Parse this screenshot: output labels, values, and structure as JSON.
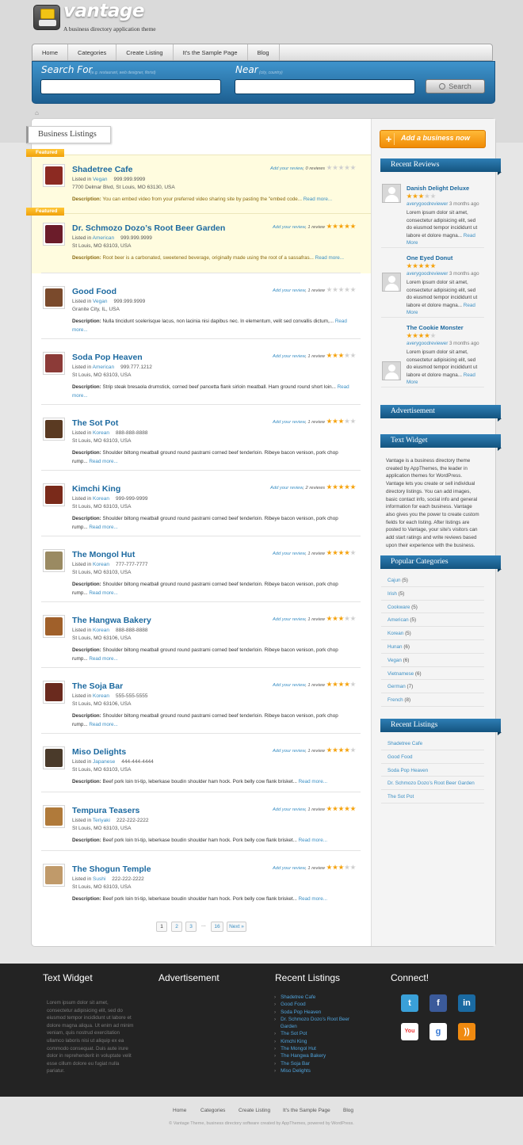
{
  "site": {
    "name": "vantage",
    "tagline": "A business directory application theme"
  },
  "nav": [
    "Home",
    "Categories",
    "Create Listing",
    "It's the Sample Page",
    "Blog"
  ],
  "search": {
    "for_label": "Search For",
    "for_hint": "(e.g. restaurant, web designer, florist)",
    "near_label": "Near",
    "near_hint": "(city, country)",
    "button": "Search"
  },
  "main": {
    "tab_title": "Business Listings",
    "featured_label": "Featured",
    "listed_in": "Listed in",
    "description_label": "Description:",
    "read_more": "Read more...",
    "add_review": "Add your review",
    "listings": [
      {
        "name": "Shadetree Cafe",
        "category": "Vegan",
        "phone": "999.999.9999",
        "address": "7700 Delmar Blvd, St Louis, MO 63130, USA",
        "reviews": ", 0 reviews",
        "rating": 0,
        "featured": true,
        "desc_a": "You can embed video from your preferred video sharing site by pasting the \"embed code...",
        "desc_b": "",
        "thumb": "#8c2a22"
      },
      {
        "name": "Dr. Schmozo Dozo’s Root Beer Garden",
        "category": "American",
        "phone": "999.999.9999",
        "address": "St Louis, MO 63103, USA",
        "reviews": ", 1 review",
        "rating": 5,
        "featured": true,
        "desc_a": "Root beer is a carbonated, sweetened beverage, originally made using the root of a sassafras...",
        "desc_b": "",
        "thumb": "#6b1c2a"
      },
      {
        "name": "Good Food",
        "category": "Vegan",
        "phone": "999.999.9999",
        "address": "Granite City, IL, USA",
        "reviews": ", 1 review",
        "rating": 0,
        "featured": false,
        "desc_a": "Nulla tincidunt scelerisque lacus, non lacinia nisi dapibus nec. In elementum, velit sed convallis dictum,...",
        "desc_b": "more...",
        "thumb": "#7a4a2c"
      },
      {
        "name": "Soda Pop Heaven",
        "category": "American",
        "phone": "999.777.1212",
        "address": "St Louis, MO 63103, USA",
        "reviews": ", 1 review",
        "rating": 3,
        "featured": false,
        "desc_a": "Strip steak bresaola drumstick, corned beef pancetta flank sirloin meatball. Ham ground round short loin...",
        "desc_b": "more...",
        "thumb": "#8c3b38"
      },
      {
        "name": "The Sot Pot",
        "category": "Korean",
        "phone": "888-888-8888",
        "address": "St Louis, MO 63103, USA",
        "reviews": ", 1 review",
        "rating": 3,
        "featured": false,
        "desc_a": "Shoulder biltong meatball ground round pastrami corned beef tenderloin. Ribeye bacon venison, pork chop",
        "desc_b": "rump...",
        "thumb": "#5a3a22"
      },
      {
        "name": "Kimchi King",
        "category": "Korean",
        "phone": "999-999-9999",
        "address": "St Louis, MO 63103, USA",
        "reviews": ", 2 reviews",
        "rating": 5,
        "featured": false,
        "desc_a": "Shoulder biltong meatball ground round pastrami corned beef tenderloin. Ribeye bacon venison, pork chop",
        "desc_b": "rump...",
        "thumb": "#7a2a1a"
      },
      {
        "name": "The Mongol Hut",
        "category": "Korean",
        "phone": "777-777-7777",
        "address": "St Louis, MO 63103, USA",
        "reviews": ", 1 review",
        "rating": 4,
        "featured": false,
        "desc_a": "Shoulder biltong meatball ground round pastrami corned beef tenderloin. Ribeye bacon venison, pork chop",
        "desc_b": "rump...",
        "thumb": "#9a8a62"
      },
      {
        "name": "The Hangwa Bakery",
        "category": "Korean",
        "phone": "888-888-8888",
        "address": "St Louis, MO 63106, USA",
        "reviews": ", 1 review",
        "rating": 3,
        "featured": false,
        "desc_a": "Shoulder biltong meatball ground round pastrami corned beef tenderloin. Ribeye bacon venison, pork chop",
        "desc_b": "rump...",
        "thumb": "#a0602a"
      },
      {
        "name": "The Soja Bar",
        "category": "Korean",
        "phone": "555-555-5555",
        "address": "St Louis, MO 63106, USA",
        "reviews": ", 1 review",
        "rating": 4,
        "featured": false,
        "desc_a": "Shoulder biltong meatball ground round pastrami corned beef tenderloin. Ribeye bacon venison, pork chop",
        "desc_b": "rump...",
        "thumb": "#6a2a1e"
      },
      {
        "name": "Miso Delights",
        "category": "Japanese",
        "phone": "444-444-4444",
        "address": "St Louis, MO 63103, USA",
        "reviews": ", 1 review",
        "rating": 4,
        "featured": false,
        "desc_a": "Beef pork loin tri-tip, leberkase boudin shoulder ham hock. Pork belly cow flank brisket...",
        "desc_b": "",
        "thumb": "#4a3a2a"
      },
      {
        "name": "Tempura Teasers",
        "category": "Teriyaki",
        "phone": "222-222-2222",
        "address": "St Louis, MO 63103, USA",
        "reviews": ", 1 review",
        "rating": 5,
        "featured": false,
        "desc_a": "Beef pork loin tri-tip, leberkase boudin shoulder ham hock. Pork belly cow flank brisket...",
        "desc_b": "",
        "thumb": "#b07a3a"
      },
      {
        "name": "The Shogun Temple",
        "category": "Sushi",
        "phone": "222-222-2222",
        "address": "St Louis, MO 63103, USA",
        "reviews": ", 1 review",
        "rating": 3,
        "featured": false,
        "desc_a": "Beef pork loin tri-tip, leberkase boudin shoulder ham hock. Pork belly cow flank brisket...",
        "desc_b": "",
        "thumb": "#c09a6a"
      }
    ],
    "pagination": [
      "1",
      "2",
      "3",
      "...",
      "16",
      "Next »"
    ]
  },
  "sidebar": {
    "add_button": "Add a business now",
    "recent_reviews_title": "Recent Reviews",
    "reviews": [
      {
        "title": "Danish Delight Deluxe",
        "rating": 3,
        "by": "averygoodreviewer",
        "when": "3 months ago",
        "text": "Lorem ipsum dolor sit amet, consectetur adipisicing elit, sed do eiusmod tempor incididunt ut labore et dolore magna...",
        "more": "Read More"
      },
      {
        "title": "One Eyed Donut",
        "rating": 5,
        "by": "averygoodreviewer",
        "when": "3 months ago",
        "text": "Lorem ipsum dolor sit amet, consectetur adipisicing elit, sed do eiusmod tempor incididunt ut labore et dolore magna...",
        "more": "Read More"
      },
      {
        "title": "The Cookie Monster",
        "rating": 4,
        "by": "averygoodreviewer",
        "when": "3 months ago",
        "text": "Lorem ipsum dolor sit amet, consectetur adipisicing elit, sed do eiusmod tempor incididunt ut labore et dolore magna...",
        "more": "Read More"
      }
    ],
    "advertisement_title": "Advertisement",
    "text_widget_title": "Text Widget",
    "text_widget_body": "Vantage is a business directory theme created by AppThemes, the leader in application themes for WordPress. Vantage lets you create or sell individual directory listings. You can add images, basic contact info, social info and general information for each business. Vantage also gives you the power to create custom fields for each listing. After listings are posted to Vantage, your site's visitors can add start ratings and write reviews based upon their experience with the business.",
    "popular_categories_title": "Popular Categories",
    "categories": [
      {
        "name": "Cajun",
        "count": "(5)"
      },
      {
        "name": "Irish",
        "count": "(5)"
      },
      {
        "name": "Cookware",
        "count": "(5)"
      },
      {
        "name": "American",
        "count": "(5)"
      },
      {
        "name": "Korean",
        "count": "(5)"
      },
      {
        "name": "Hunan",
        "count": "(6)"
      },
      {
        "name": "Vegan",
        "count": "(6)"
      },
      {
        "name": "Vietnamese",
        "count": "(6)"
      },
      {
        "name": "German",
        "count": "(7)"
      },
      {
        "name": "French",
        "count": "(8)"
      }
    ],
    "recent_listings_title": "Recent Listings",
    "recent_listings": [
      "Shadetree Cafe",
      "Good Food",
      "Soda Pop Heaven",
      "Dr. Schmozo Dozo’s Root Beer Garden",
      "The Sot Pot"
    ]
  },
  "footer": {
    "text_widget_title": "Text Widget",
    "text_widget_body": "Lorem ipsum dolor sit amet, consectetur adipisicing elit, sed do eiusmod tempor incididunt ut labore et dolore magna aliqua. Ut enim ad minim veniam, quis nostrud exercitation ullamco laboris nisi ut aliquip ex ea commodo consequat. Duis aute irure dolor in reprehenderit in voluptate velit esse cillum dolore eu fugiat nulla pariatur.",
    "advertisement_title": "Advertisement",
    "recent_listings_title": "Recent Listings",
    "recent_listings": [
      "Shadetree Cafe",
      "Good Food",
      "Soda Pop Heaven",
      "Dr. Schmozo Dozo’s Root Beer",
      "Garden",
      "The Sot Pot",
      "Kimchi King",
      "The Mongol Hut",
      "The Hangwa Bakery",
      "The Soja Bar",
      "Miso Delights"
    ],
    "connect_title": "Connect!",
    "social": [
      {
        "icon": "twitter-icon",
        "glyph": "t",
        "color": "#3aa0d8"
      },
      {
        "icon": "facebook-icon",
        "glyph": "f",
        "color": "#3b5a9a"
      },
      {
        "icon": "linkedin-icon",
        "glyph": "in",
        "color": "#1a6aa2"
      },
      {
        "icon": "youtube-icon",
        "glyph": "You",
        "color": "#e33"
      },
      {
        "icon": "google-icon",
        "glyph": "g",
        "color": "#3a7bd5"
      },
      {
        "icon": "rss-icon",
        "glyph": "))",
        "color": "#f08a10"
      }
    ]
  },
  "bottom_nav": [
    "Home",
    "Categories",
    "Create Listing",
    "It's the Sample Page",
    "Blog"
  ],
  "copyright": "© Vantage Theme, business directory software created by AppThemes, powered by WordPress."
}
